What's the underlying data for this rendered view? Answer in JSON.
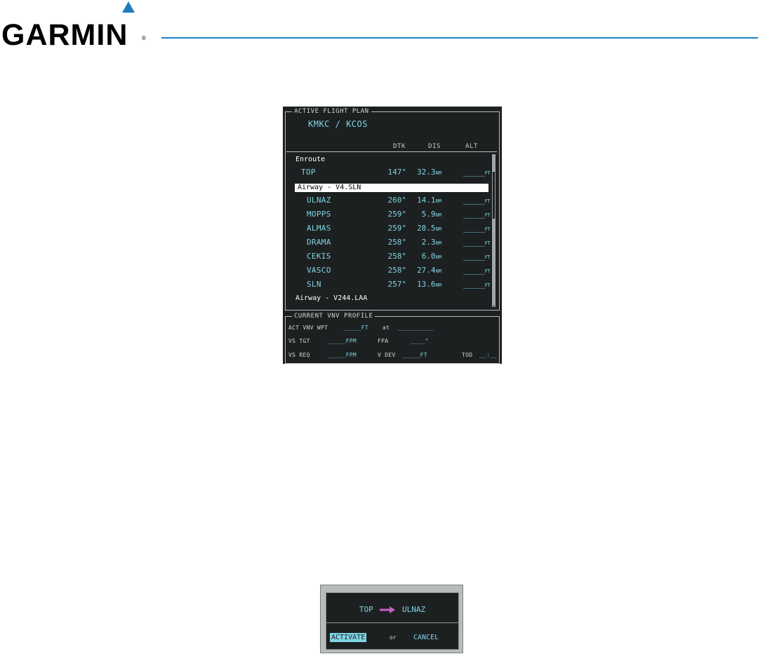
{
  "brand": {
    "name": "GARMIN",
    "reg": "®",
    "accent": "#1d7bc2"
  },
  "flight_plan": {
    "title": "ACTIVE FLIGHT PLAN",
    "route": "KMKC / KCOS",
    "columns": {
      "dtk": "DTK",
      "dis": "DIS",
      "alt": "ALT"
    },
    "enroute_label": "Enroute",
    "top_row": {
      "wpt": "TOP",
      "dtk": "147°",
      "dis": "32.3",
      "dis_unit": "NM",
      "alt": "_____",
      "alt_unit": "FT"
    },
    "airway_selected": "Airway - V4.SLN",
    "waypoints": [
      {
        "wpt": "ULNAZ",
        "dtk": "260°",
        "dis": "14.1",
        "dis_unit": "NM",
        "alt": "_____",
        "alt_unit": "FT"
      },
      {
        "wpt": "MOPPS",
        "dtk": "259°",
        "dis": "5.9",
        "dis_unit": "NM",
        "alt": "_____",
        "alt_unit": "FT"
      },
      {
        "wpt": "ALMAS",
        "dtk": "259°",
        "dis": "28.5",
        "dis_unit": "NM",
        "alt": "_____",
        "alt_unit": "FT"
      },
      {
        "wpt": "DRAMA",
        "dtk": "258°",
        "dis": "2.3",
        "dis_unit": "NM",
        "alt": "_____",
        "alt_unit": "FT"
      },
      {
        "wpt": "CEKIS",
        "dtk": "258°",
        "dis": "6.0",
        "dis_unit": "NM",
        "alt": "_____",
        "alt_unit": "FT"
      },
      {
        "wpt": "VASCO",
        "dtk": "258°",
        "dis": "27.4",
        "dis_unit": "NM",
        "alt": "_____",
        "alt_unit": "FT"
      },
      {
        "wpt": "SLN",
        "dtk": "257°",
        "dis": "13.6",
        "dis_unit": "NM",
        "alt": "_____",
        "alt_unit": "FT"
      }
    ],
    "airway_next": "Airway - V244.LAA"
  },
  "vnv": {
    "title": "CURRENT VNV PROFILE",
    "act_wpt_label": "ACT VNV WPT",
    "act_wpt_alt": "_____FT",
    "at_label": "at",
    "act_wpt_name": "__________",
    "vs_tgt_label": "VS TGT",
    "vs_tgt_val": "_____FPM",
    "fpa_label": "FPA",
    "fpa_val": "____°",
    "vs_req_label": "VS REQ",
    "vs_req_val": "_____FPM",
    "vdev_label": "V DEV",
    "vdev_val": "_____FT",
    "tod_label": "TOD",
    "tod_val": "__:__"
  },
  "dialog": {
    "from": "TOP",
    "to": "ULNAZ",
    "arrow_color": "#c860c8",
    "activate_label": "ACTIVATE",
    "or_label": "or",
    "cancel_label": "CANCEL"
  }
}
